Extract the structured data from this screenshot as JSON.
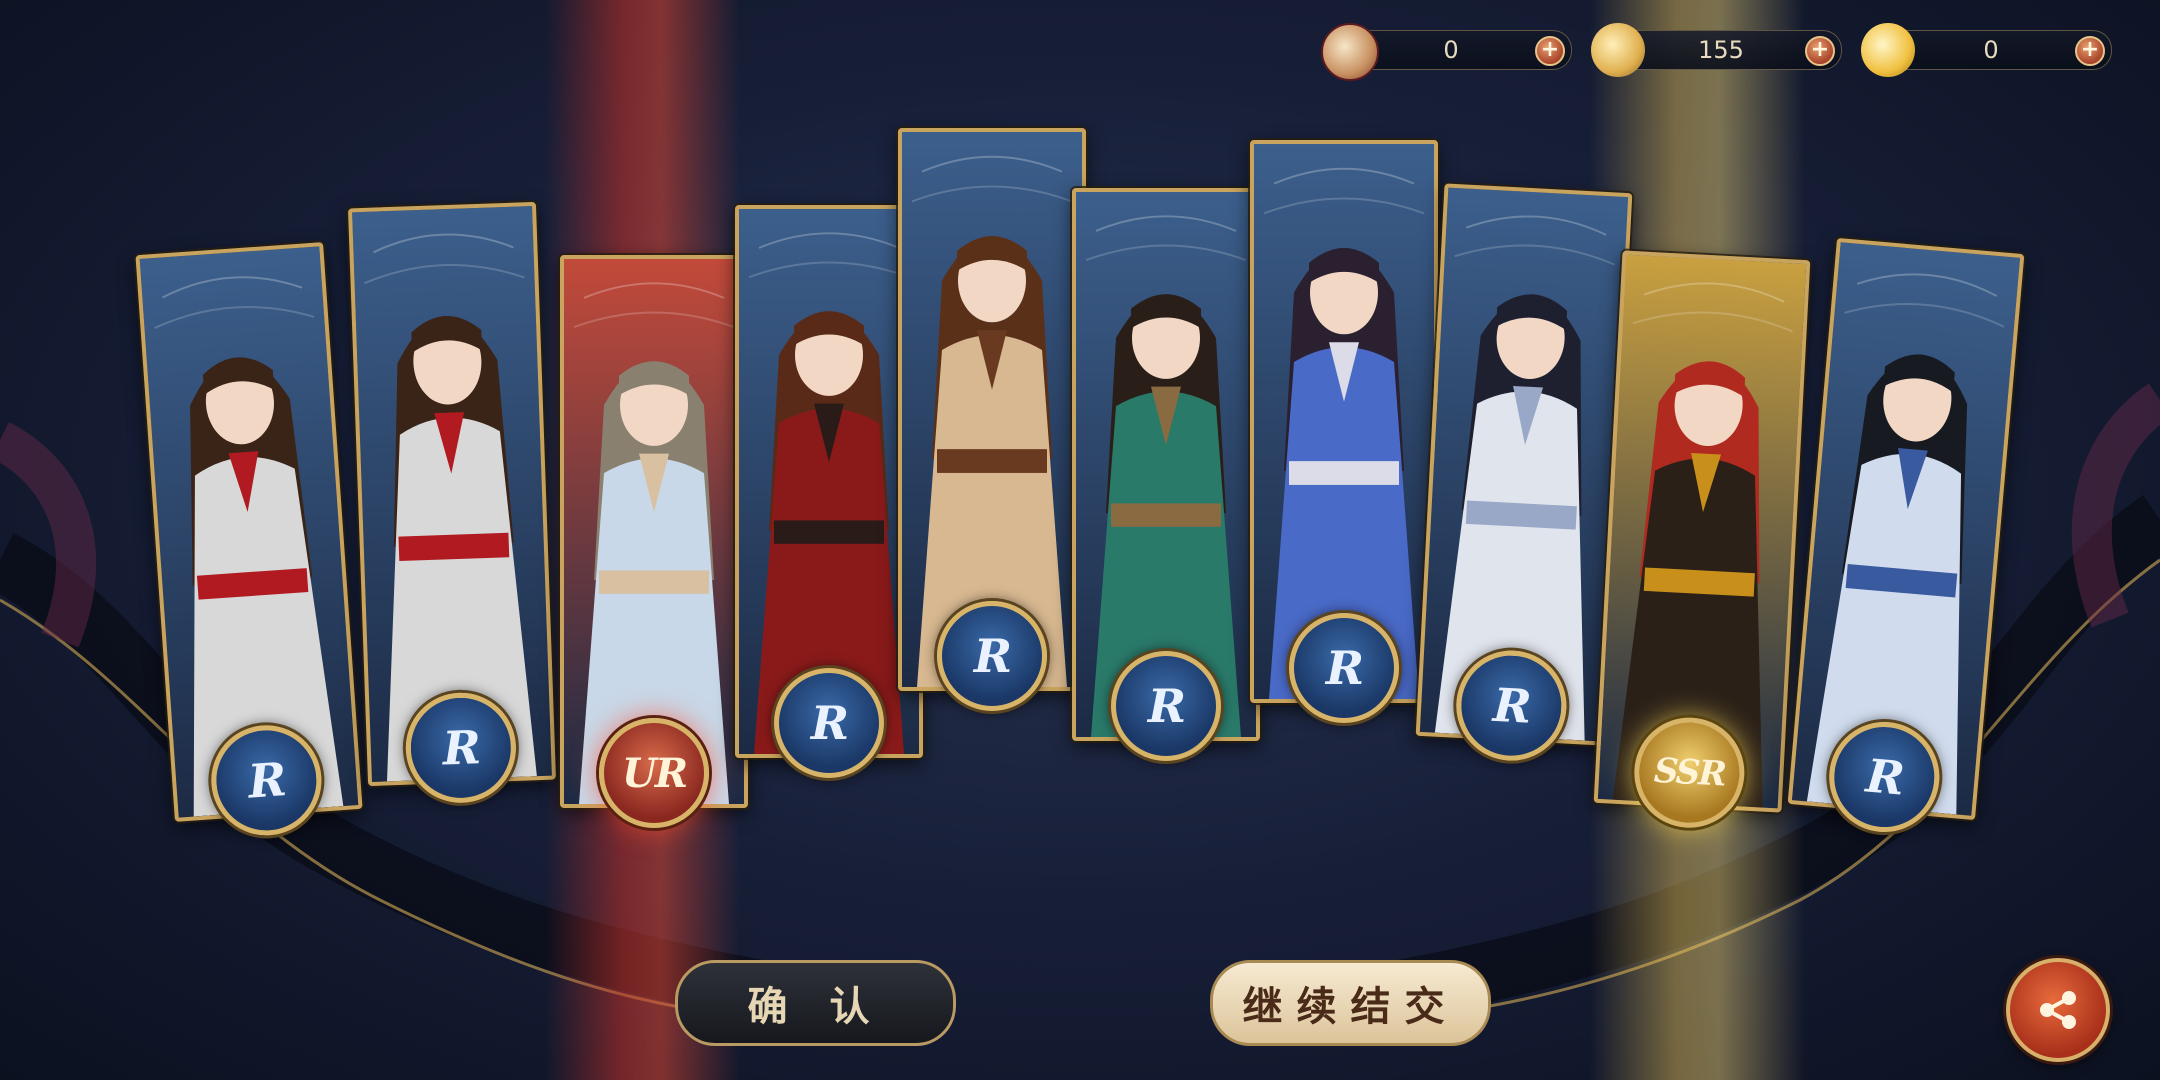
{
  "currencies": [
    {
      "icon": "jade-bead-icon",
      "amount": "0"
    },
    {
      "icon": "golden-leaf-icon",
      "amount": "155"
    },
    {
      "icon": "gold-ingot-icon",
      "amount": "0"
    }
  ],
  "cards": [
    {
      "rarity": "R",
      "character": "girl-twin-buns-red-black",
      "bg": "#3c5f8c"
    },
    {
      "rarity": "R",
      "character": "girl-twin-buns-red-black",
      "bg": "#3c5f8c"
    },
    {
      "rarity": "UR",
      "character": "scholar-silver-hair",
      "bg": "#c24a3a"
    },
    {
      "rarity": "R",
      "character": "warrior-red-armor",
      "bg": "#3c5f8c"
    },
    {
      "rarity": "R",
      "character": "swordsman-ponytail",
      "bg": "#3c5f8c"
    },
    {
      "rarity": "R",
      "character": "bearded-fan-bearer",
      "bg": "#3c5f8c"
    },
    {
      "rarity": "R",
      "character": "long-hair-blue-robe",
      "bg": "#3c5f8c"
    },
    {
      "rarity": "R",
      "character": "white-robe-youth",
      "bg": "#3c5f8c"
    },
    {
      "rarity": "SSR",
      "character": "red-hair-warrior",
      "bg": "#c9a040"
    },
    {
      "rarity": "R",
      "character": "long-black-hair-sage",
      "bg": "#3c5f8c"
    }
  ],
  "buttons": {
    "confirm": "确 认",
    "continue": "继续结交"
  },
  "share_icon": "share-icon"
}
